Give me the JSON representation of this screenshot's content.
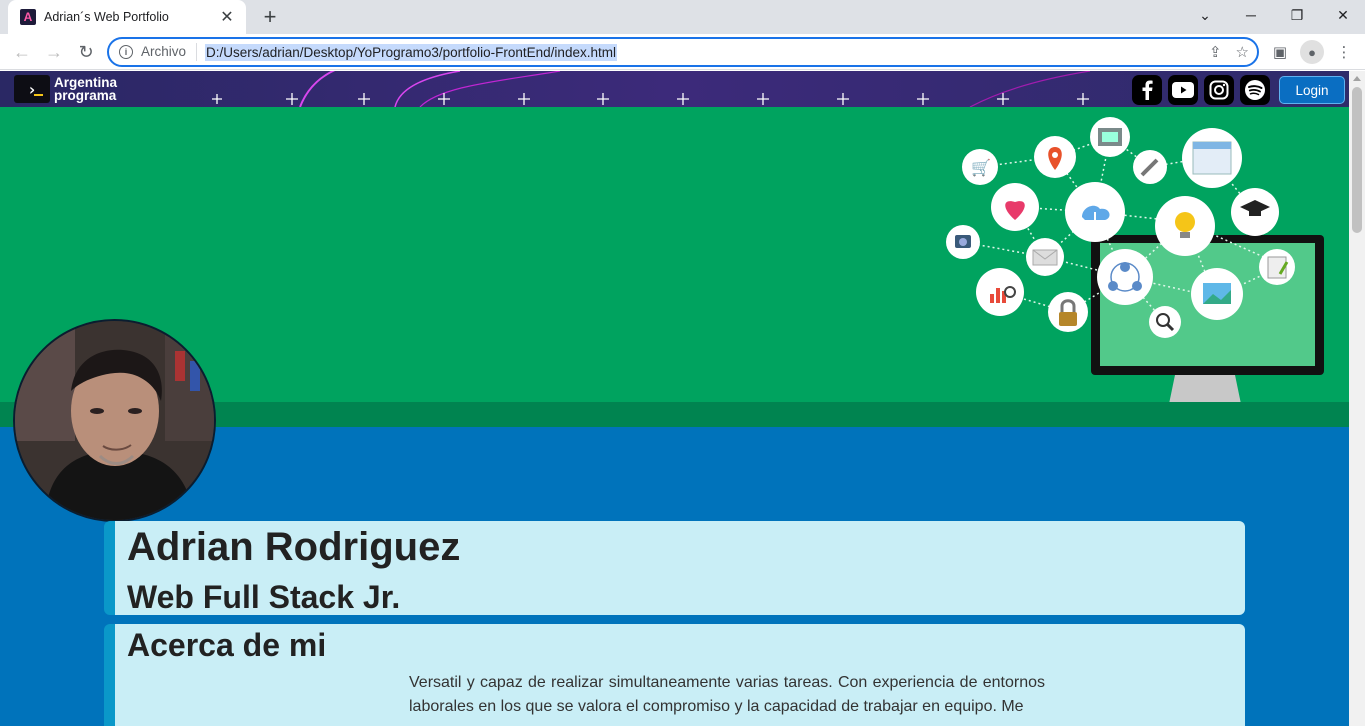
{
  "browser": {
    "tab_title": "Adrian´s Web Portfolio",
    "tab_favicon": "A",
    "chip": "Archivo",
    "url": "D:/Users/adrian/Desktop/YoProgramo3/portfolio-FrontEnd/index.html"
  },
  "site": {
    "logo_line1": "Argentina",
    "logo_line2": "programa",
    "logo_prompt": "›",
    "social": [
      "facebook-icon",
      "youtube-icon",
      "instagram-icon",
      "spotify-icon"
    ],
    "login_label": "Login"
  },
  "profile": {
    "name": "Adrian Rodriguez",
    "role": "Web Full Stack Jr."
  },
  "about": {
    "title": "Acerca de mi",
    "text": "Versatil y capaz de realizar simultaneamente varias tareas. Con experiencia de entornos laborales en los que se valora el compromiso y la capacidad de trabajar en equipo. Me"
  },
  "colors": {
    "nav": "#2e2b6a",
    "banner": "#00a35f",
    "page": "#0073bb",
    "card": "#c9eef6",
    "card_border": "#0a98c9"
  }
}
